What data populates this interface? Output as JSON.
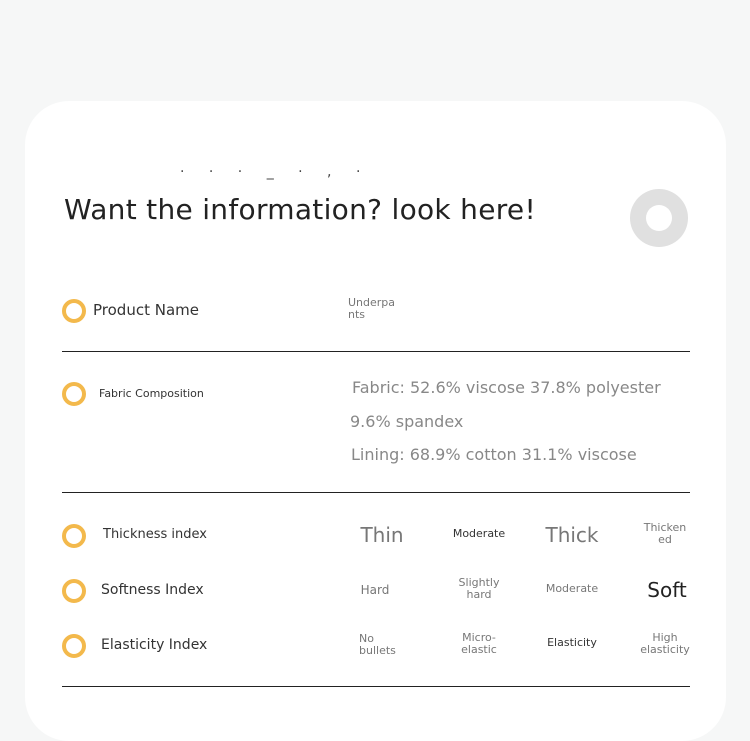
{
  "header": {
    "cut_text": "·  ·  ·  _  ·  ,  ·",
    "title": "Want the information? look here!"
  },
  "product": {
    "label": "Product Name",
    "value": "Underpants"
  },
  "fabric": {
    "label": "Fabric Composition",
    "line1": "Fabric: 52.6% viscose 37.8% polyester",
    "line2": "9.6% spandex",
    "line3": "Lining: 68.9% cotton 31.1% viscose"
  },
  "thickness": {
    "label": "Thickness index",
    "options": [
      "Thin",
      "Moderate",
      "Thick",
      "Thickened"
    ]
  },
  "softness": {
    "label": "Softness Index",
    "options": [
      "Hard",
      "Slightly hard",
      "Moderate",
      "Soft"
    ]
  },
  "elasticity": {
    "label": "Elasticity Index",
    "options": [
      "No bullets",
      "Micro-elastic",
      "Elasticity",
      "High elasticity"
    ]
  },
  "colors": {
    "accent": "#f3b94c",
    "toggle": "#e0e0e0"
  }
}
